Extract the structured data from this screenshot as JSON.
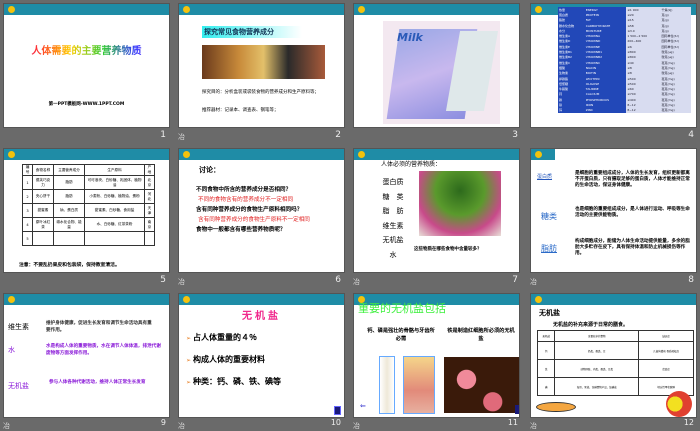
{
  "slides": [
    {
      "num": "1",
      "title": "人体需要的主要营养物质",
      "footer": "第一PPT模板网-WWW.1PPT.COM"
    },
    {
      "num": "2",
      "title": "探究常见食物营养成分",
      "bullets": [
        "探究目的：分析盒装或袋装食物的营养成分和生产原料等；",
        "推荐器材：记录本、调查表、钢笔等；"
      ]
    },
    {
      "num": "3",
      "image": "Milk"
    },
    {
      "num": "4",
      "rows": [
        [
          "热量",
          "ENERGY",
          "≥1 900",
          "千焦(kJ)"
        ],
        [
          "蛋白质",
          "PROTEIN",
          "≥20",
          "克(g)"
        ],
        [
          "脂肪",
          "FAT",
          "≥15",
          "克(g)"
        ],
        [
          "碳水化合物",
          "CARBOHYDRATE",
          "≤58",
          "克(g)"
        ],
        [
          "水分",
          "MOISTURE",
          "≤3.0",
          "克(g)"
        ],
        [
          "维生素A",
          "VITAMINA",
          "1 500~2 500",
          "国际单位(IU)"
        ],
        [
          "维生素D",
          "VITAMIND",
          "200~400",
          "国际单位(IU)"
        ],
        [
          "维生素E",
          "VITAMINE",
          "≥6",
          "国际单位(IU)"
        ],
        [
          "维生素B1",
          "VITAMINB1",
          "≥800",
          "微克(μg)"
        ],
        [
          "维生素B2",
          "VITAMINB2",
          "≥800",
          "微克(μg)"
        ],
        [
          "维生素C",
          "VITAMINC",
          "≥40",
          "毫克(mg)"
        ],
        [
          "烟酸",
          "NIACIN",
          "≥8",
          "毫克(mg)"
        ],
        [
          "生物素",
          "BIOTIN",
          "≥8",
          "微克(μg)"
        ],
        [
          "卵磷脂",
          "LECITHIN",
          "≥500",
          "毫克(mg)"
        ],
        [
          "低聚糖",
          "OLIGOSE",
          "≥500",
          "毫克(mg)"
        ],
        [
          "牛磺酸",
          "TAURINE",
          "≥60",
          "毫克(mg)"
        ],
        [
          "钙",
          "CALCIUM",
          "≥700",
          "毫克(mg)"
        ],
        [
          "磷",
          "PHOSPHOROUS",
          "≥400",
          "毫克(mg)"
        ],
        [
          "铁",
          "IRON",
          "8~12",
          "毫克(mg)"
        ],
        [
          "锌",
          "ZINC",
          "8~12",
          "毫克(mg)"
        ]
      ]
    },
    {
      "num": "5",
      "headers": [
        "编号",
        "食物名称",
        "主要营养成分",
        "生产原料",
        "产地"
      ],
      "rows": [
        [
          "1",
          "德芙巧克力",
          "脂肪",
          "可可液块、白砂糖、乳固体、植物油",
          "北京"
        ],
        [
          "2",
          "夹心饼干",
          "脂肪",
          "小麦粉、白砂糖、植物油、蛋粉",
          "河北"
        ],
        [
          "3",
          "甜蜜素",
          "钠、蛋白质",
          "甜蜜素、白砂糖、食用盐",
          "天津"
        ],
        [
          "4",
          "原叶冰红茶",
          "碳水化合物、能量",
          "水、白砂糖、红茶茶粉",
          "南京"
        ],
        [
          "5",
          "",
          "",
          "",
          ""
        ]
      ],
      "note": "注意：不要乱扔果皮和包装袋，保持教室清洁。"
    },
    {
      "num": "6",
      "title": "讨论：",
      "lines": [
        {
          "t": "不同食物中所含的营养成分是否相同？",
          "c": "#000"
        },
        {
          "t": "不同的食物含有的营养成分不一定相同",
          "c": "#e02020"
        },
        {
          "t": "含有同种营养成分的食物生产原料相同吗？",
          "c": "#000"
        },
        {
          "t": "含有同种营养成分的食物生产原料不一定相同",
          "c": "#e02020"
        },
        {
          "t": "食物中一般都含有哪些营养物质呢？",
          "c": "#000"
        }
      ]
    },
    {
      "num": "7",
      "title": "人体必须的营养物质：",
      "items": [
        "蛋白质",
        "糖　类",
        "脂　肪",
        "维生素",
        "无机盐",
        "水"
      ],
      "question": "这些物质在哪些食物中含量较多？"
    },
    {
      "num": "8",
      "items": [
        {
          "k": "蛋白质",
          "v": "是细胞的重要组成成分，人体的生长发育，组织更新都离不开蛋白质，只有摄取足够的蛋白质，人体才能维持正常的生命活动，保证身体健康。"
        },
        {
          "k": "糖类",
          "v": "也是细胞的重要组成成分，是人体进行运动、呼吸等生命活动的主要供能物质。"
        },
        {
          "k": "脂肪",
          "v": "构成细胞成分，能储为人体生命活动提供能量，多余的脂肪大多贮存在皮下，具有保持体温和防止机械损伤等作用。"
        }
      ]
    },
    {
      "num": "9",
      "items": [
        {
          "k": "维生素",
          "v": "维护身体健康，促进生长发育和调节生命活动具有重要作用。"
        },
        {
          "k": "水",
          "v": "水是构成人体的重要物质，水在调节人体体温，排泄代谢废物等方面发挥作用。"
        },
        {
          "k": "无机盐",
          "v": "参与人体各种代谢活动，维持人体正常生长发育"
        }
      ]
    },
    {
      "num": "10",
      "title": "无机盐",
      "bullets": [
        "占人体重量的４％",
        "构成人体的重要材料",
        "种类：钙、磷、铁、碘等"
      ]
    },
    {
      "num": "11",
      "title": "重要的无机盐包括",
      "left": "钙、磷是强壮的骨骼与牙齿所必需",
      "right": "铁是制造红细胞所必须的无机盐"
    },
    {
      "num": "12",
      "title": "无机盐",
      "subtitle": "无机盐的补充来源于日常的膳食。",
      "headers": [
        "无机盐",
        "含量较多的食物",
        "缺乏症"
      ],
      "rows": [
        [
          "钙",
          "奶类、蛋类、豆",
          "儿童佝偻病 骨质疏松症"
        ],
        [
          "铁",
          "动物肝脏、肉类、蛋类、豆类",
          "贫血症"
        ],
        [
          "碘",
          "海带、紫菜、含碘食物产品、加碘盐",
          "地方性甲状腺肿"
        ]
      ]
    }
  ],
  "anim_icon": "冶"
}
